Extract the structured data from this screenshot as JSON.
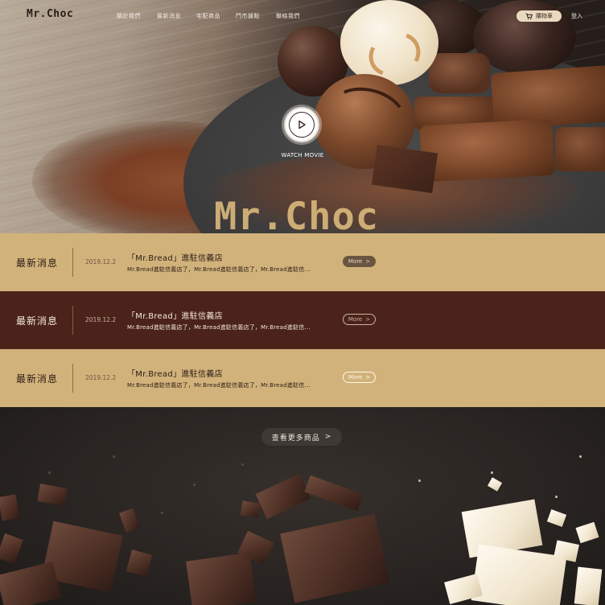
{
  "header": {
    "logo": "Mr.Choc",
    "nav": [
      "關於我們",
      "最新消息",
      "宅配商品",
      "門市據點",
      "聯絡我們"
    ],
    "cart_label": "購物車",
    "login_label": "登入"
  },
  "hero": {
    "watch_label": "WATCH MOVIE",
    "brand_title": "Mr.Choc"
  },
  "news": [
    {
      "label": "最新消息",
      "date": "2019.12.2",
      "title": "「Mr.Bread」進駐信義店",
      "snippet": "Mr.Bread進駐信義店了，Mr.Bread進駐信義店了，Mr.Bread進駐信...",
      "more": "More"
    },
    {
      "label": "最新消息",
      "date": "2019.12.2",
      "title": "「Mr.Bread」進駐信義店",
      "snippet": "Mr.Bread進駐信義店了，Mr.Bread進駐信義店了，Mr.Bread進駐信...",
      "more": "More"
    },
    {
      "label": "最新消息",
      "date": "2019.12.2",
      "title": "「Mr.Bread」進駐信義店",
      "snippet": "Mr.Bread進駐信義店了，Mr.Bread進駐信義店了，Mr.Bread進駐信...",
      "more": "More"
    }
  ],
  "products": {
    "more_label": "查看更多商品"
  },
  "colors": {
    "gold": "#d2b27b",
    "brown": "#4b231a",
    "dark": "#2a2522"
  },
  "icons": {
    "cart": "cart-icon",
    "play": "play-icon",
    "chevron": "chevron-right-icon"
  }
}
